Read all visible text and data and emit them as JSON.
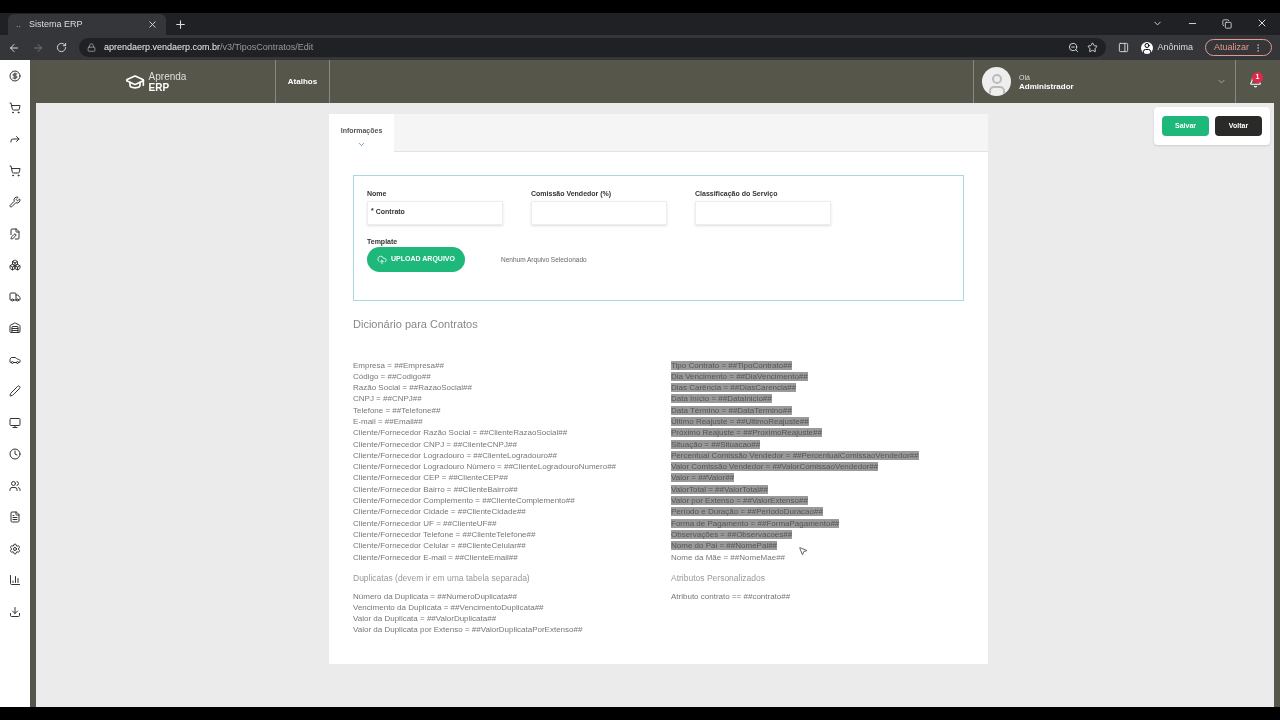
{
  "browser": {
    "tab_title": "Sistema ERP",
    "tab_prefix": "..",
    "url_host": "aprendaerp.vendaerp.com.br",
    "url_path": "/v3/TiposContratos/Edit",
    "profile": "Anônima",
    "update_button": "Atualizar"
  },
  "header": {
    "logo_top": "Aprenda",
    "logo_bottom": "ERP",
    "shortcuts": "Atalhos",
    "greeting": "Olá",
    "user": "Administrador",
    "notifications": "1"
  },
  "actions": [
    {
      "label": "Salvar",
      "kind": "primary"
    },
    {
      "label": "Voltar",
      "kind": "dark"
    }
  ],
  "tabs": [
    {
      "label": "Informações",
      "selected": true
    }
  ],
  "form": {
    "fields": [
      {
        "label": "Nome",
        "required_mark": "*",
        "value": "Contrato"
      },
      {
        "label": "Comissão Vendedor (%)"
      },
      {
        "label": "Classificação do Serviço"
      }
    ],
    "template_label": "Template",
    "upload_button": "UPLOAD ARQUIVO",
    "file_status": "Nenhum Arquivo Selecionado"
  },
  "dictionary": {
    "title": "Dicionário para Contratos",
    "left": [
      {
        "text": "Empresa = ##Empresa##",
        "selected": false
      },
      {
        "text": "Código = ##Codigo##",
        "selected": false
      },
      {
        "text": "Razão Social = ##RazaoSocial##",
        "selected": false
      },
      {
        "text": "CNPJ = ##CNPJ##",
        "selected": false
      },
      {
        "text": "Telefone = ##Telefone##",
        "selected": false
      },
      {
        "text": "E-mail = ##Email##",
        "selected": false
      },
      {
        "text": "Cliente/Fornecedor Razão Social = ##ClienteRazaoSocial##",
        "selected": false
      },
      {
        "text": "Cliente/Fornecedor CNPJ = ##ClienteCNPJ##",
        "selected": false
      },
      {
        "text": "Cliente/Fornecedor Logradouro = ##ClienteLogradouro##",
        "selected": false
      },
      {
        "text": "Cliente/Fornecedor Logradouro Número = ##ClienteLogradouroNumero##",
        "selected": false
      },
      {
        "text": "Cliente/Fornecedor CEP = ##ClienteCEP##",
        "selected": false
      },
      {
        "text": "Cliente/Fornecedor Bairro = ##ClienteBairro##",
        "selected": false
      },
      {
        "text": "Cliente/Fornecedor Complemento = ##ClienteComplemento##",
        "selected": false
      },
      {
        "text": "Cliente/Fornecedor Cidade = ##ClienteCidade##",
        "selected": false
      },
      {
        "text": "Cliente/Fornecedor UF = ##ClienteUF##",
        "selected": false
      },
      {
        "text": "Cliente/Fornecedor Telefone = ##ClienteTelefone##",
        "selected": false
      },
      {
        "text": "Cliente/Fornecedor Celular = ##ClienteCelular##",
        "selected": false
      },
      {
        "text": "Cliente/Fornecedor E-mail = ##ClienteEmail##",
        "selected": false
      }
    ],
    "right": [
      {
        "text": "Tipo Contrato = ##TipoContrato##",
        "selected": true
      },
      {
        "text": "Dia Vencimento = ##DiaVencimento##",
        "selected": true
      },
      {
        "text": "Dias Carência = ##DiasCarencia##",
        "selected": true
      },
      {
        "text": "Data Início = ##DataInicio##",
        "selected": true
      },
      {
        "text": "Data Término = ##DataTermino##",
        "selected": true
      },
      {
        "text": "Último Reajuste = ##UltimoReajuste##",
        "selected": true
      },
      {
        "text": "Próximo Reajuste = ##ProximoReajuste##",
        "selected": true
      },
      {
        "text": "Situação = ##Situacao##",
        "selected": true
      },
      {
        "text": "Percentual Comissão Vendedor = ##PercentualComissaoVendedor##",
        "selected": true
      },
      {
        "text": "Valor Comissão Vendedor = ##ValorComissaoVendedor##",
        "selected": true
      },
      {
        "text": "Valor = ##Valor##",
        "selected": true
      },
      {
        "text": "ValorTotal = ##ValorTotal##",
        "selected": true
      },
      {
        "text": "Valor por Extenso = ##ValorExtenso##",
        "selected": true
      },
      {
        "text": "Período e Duração = ##PeriodoDuracao##",
        "selected": true
      },
      {
        "text": "Forma de Pagamento = ##FormaPagamento##",
        "selected": true
      },
      {
        "text": "Observações = ##Observacoes##",
        "selected": true
      },
      {
        "text": "Nome do Pai = ##NomePai##",
        "selected": true
      },
      {
        "text": "Nome da Mãe = ##NomeMae##",
        "selected": false
      }
    ],
    "duplicates_title": "Duplicatas (devem ir em uma tabela separada)",
    "duplicates": [
      {
        "text": "Número da Duplicata = ##NumeroDuplicata##",
        "selected": false
      },
      {
        "text": "Vencimento da Duplicata = ##VencimentoDuplicata##",
        "selected": false
      },
      {
        "text": "Valor da Duplicata = ##ValorDuplicata##",
        "selected": false
      },
      {
        "text": "Valor da Duplicata por Extenso = ##ValorDuplicataPorExtenso##",
        "selected": false
      }
    ],
    "custom_title": "Atributos Personalizados",
    "custom": [
      {
        "text": "Atributo contrato == ##contrato##",
        "selected": false
      }
    ]
  }
}
